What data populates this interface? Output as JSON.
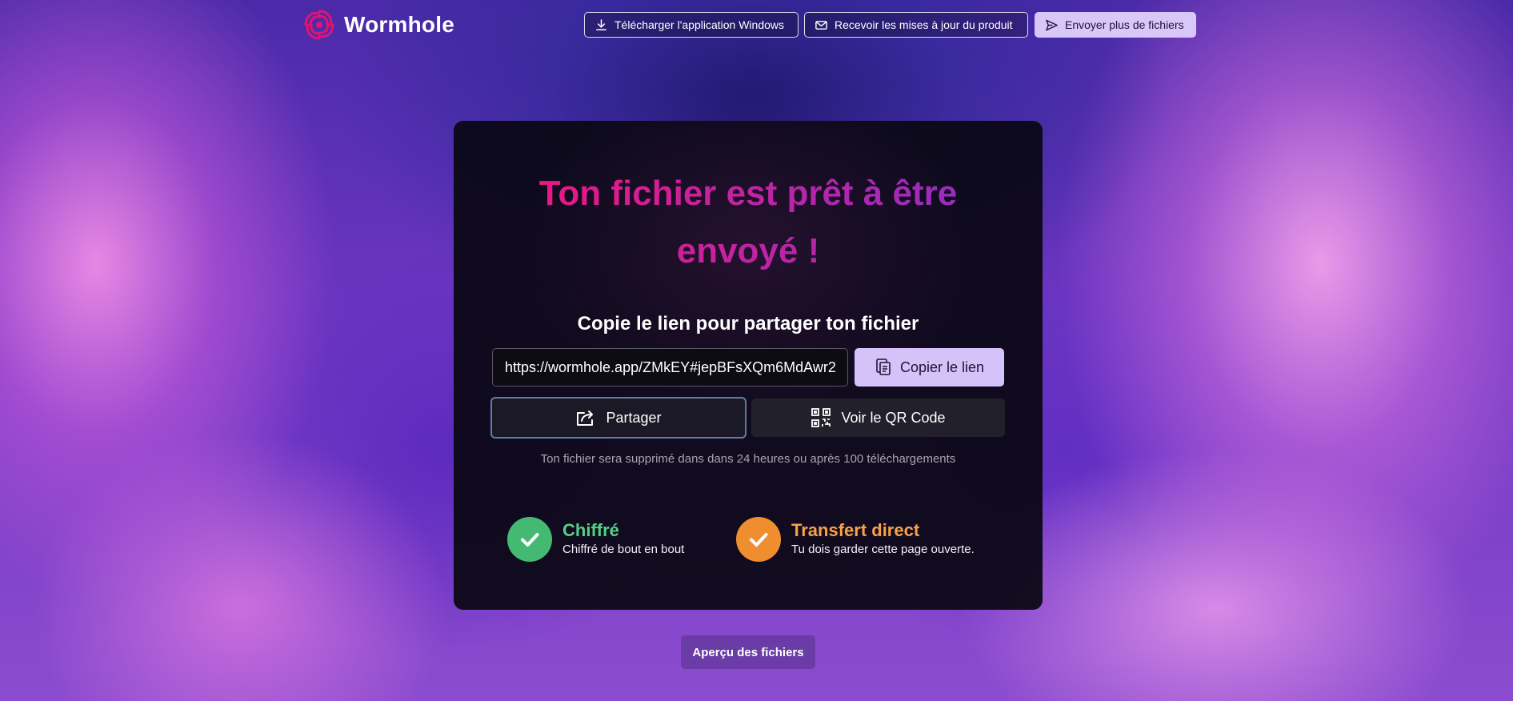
{
  "brand": {
    "name": "Wormhole",
    "logo_icon": "wormhole-spiral-icon",
    "logo_color": "#e4136f"
  },
  "header": {
    "download_windows": {
      "label": "Télécharger l'application Windows",
      "icon": "download-icon"
    },
    "product_updates": {
      "label": "Recevoir les mises à jour du produit",
      "icon": "mail-icon"
    },
    "send_more": {
      "label": "Envoyer plus de fichiers",
      "icon": "send-icon"
    }
  },
  "card": {
    "title": "Ton fichier est prêt à être envoyé !",
    "share_heading": "Copie le lien pour partager ton fichier",
    "link_value": "https://wormhole.app/ZMkEY#jepBFsXQm6MdAwr2",
    "copy_label": "Copier le lien",
    "share_label": "Partager",
    "qr_label": "Voir le QR Code",
    "expiry_note": "Ton fichier sera supprimé dans dans 24 heures ou après 100 téléchargements",
    "features": [
      {
        "title": "Chiffré",
        "description": "Chiffré de bout en bout",
        "color": "#44b972",
        "icon": "check-icon"
      },
      {
        "title": "Transfert direct",
        "description": "Tu dois garder cette page ouverte.",
        "color": "#ef8e2f",
        "icon": "check-icon"
      }
    ]
  },
  "preview_label": "Aperçu des fichiers",
  "colors": {
    "accent": "#d4c2f9",
    "title_gradient_start": "#f5147d",
    "title_gradient_end": "#8e2ec8"
  }
}
